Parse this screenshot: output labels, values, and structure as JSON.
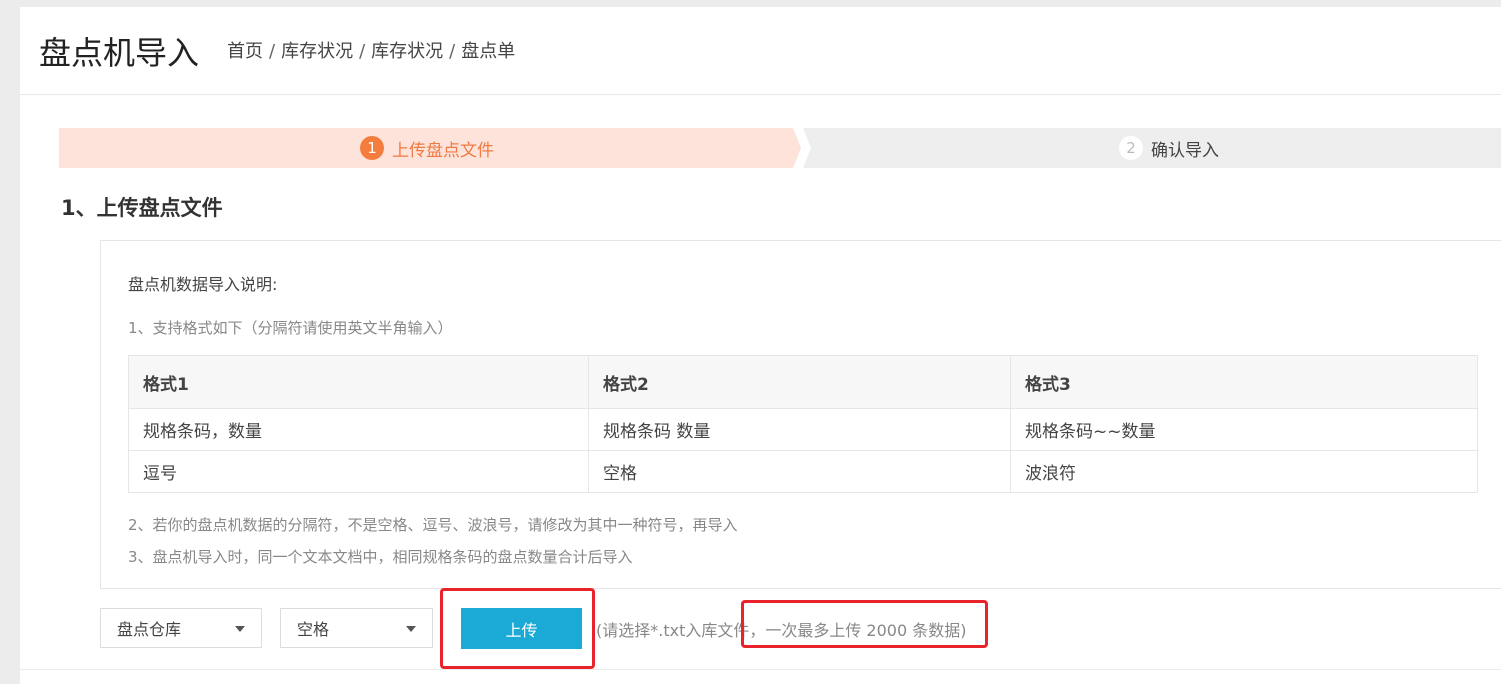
{
  "header": {
    "title": "盘点机导入",
    "breadcrumb": [
      "首页",
      "库存状况",
      "库存状况",
      "盘点单"
    ],
    "separator": "/"
  },
  "steps": [
    {
      "num": "1",
      "label": "上传盘点文件",
      "active": true
    },
    {
      "num": "2",
      "label": "确认导入",
      "active": false
    }
  ],
  "section_title": "1、上传盘点文件",
  "instructions": {
    "heading": "盘点机数据导入说明:",
    "line1": "1、支持格式如下（分隔符请使用英文半角输入）",
    "table": {
      "headers": [
        "格式1",
        "格式2",
        "格式3"
      ],
      "rows": [
        [
          "规格条码，数量",
          "规格条码 数量",
          "规格条码~~数量"
        ],
        [
          "逗号",
          "空格",
          "波浪符"
        ]
      ]
    },
    "line2": "2、若你的盘点机数据的分隔符，不是空格、逗号、波浪号，请修改为其中一种符号，再导入",
    "line3": "3、盘点机导入时，同一个文本文档中，相同规格条码的盘点数量合计后导入"
  },
  "controls": {
    "warehouse_select": "盘点仓库",
    "separator_select": "空格",
    "upload_label": "上传",
    "hint": "(请选择*.txt入库文件，一次最多上传 2000 条数据)"
  },
  "colors": {
    "accent": "#f47c3c",
    "primary_button": "#1ba9d6",
    "annotation_red": "#e8232b"
  }
}
